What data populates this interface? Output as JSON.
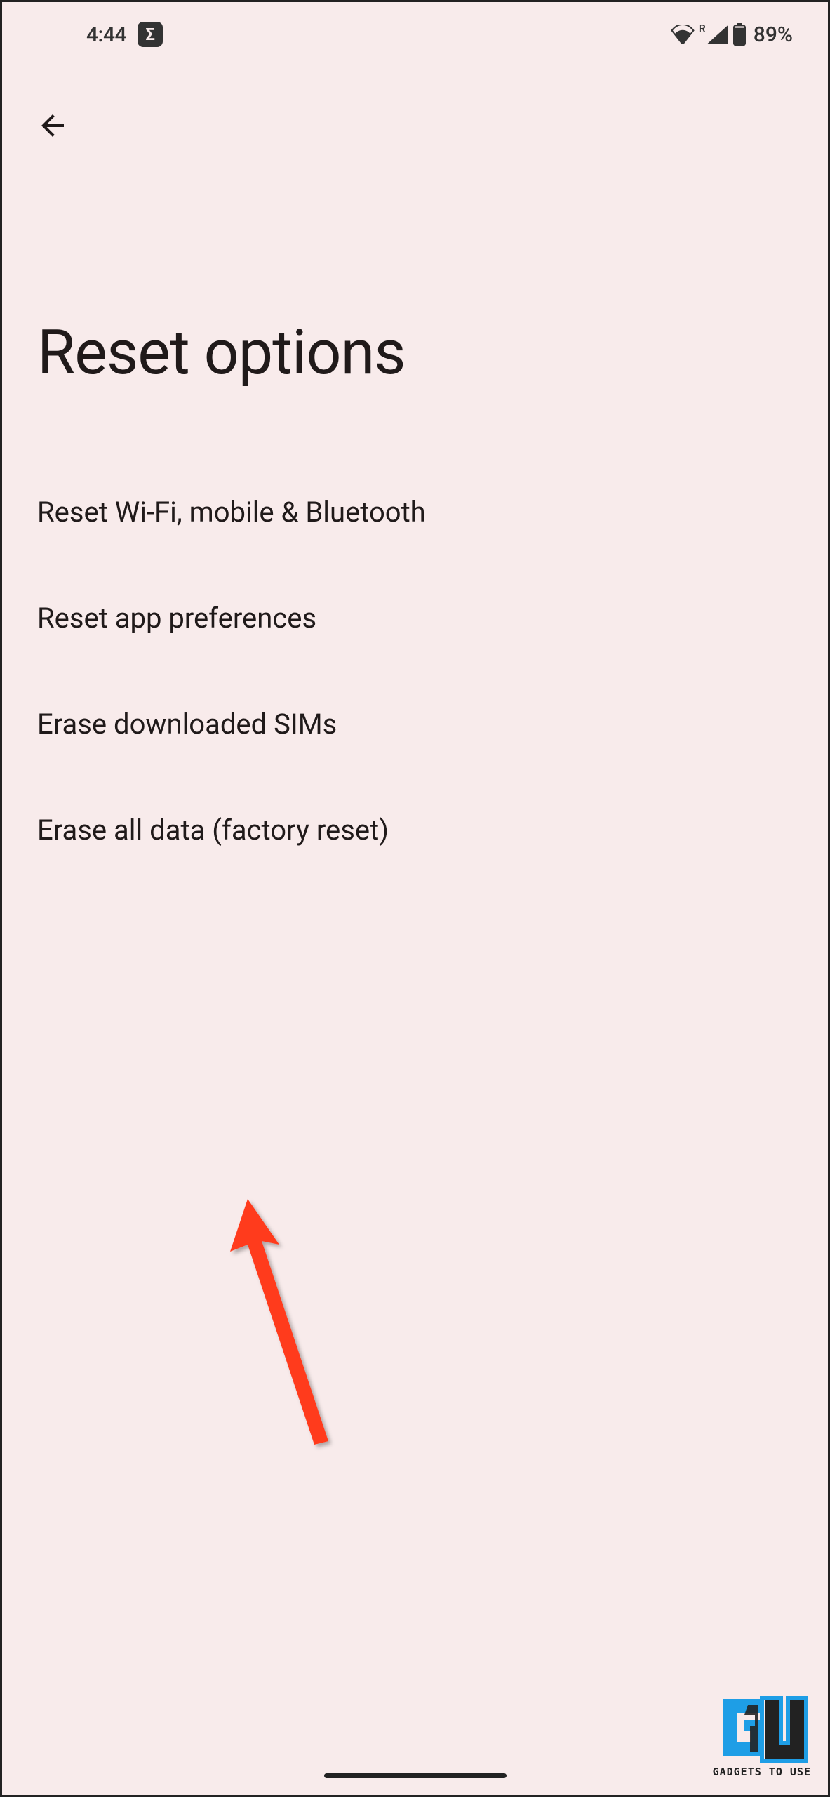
{
  "status_bar": {
    "time": "4:44",
    "battery_percent": "89%",
    "roaming_indicator": "R"
  },
  "header": {
    "title": "Reset options"
  },
  "options": [
    {
      "label": "Reset Wi-Fi, mobile & Bluetooth"
    },
    {
      "label": "Reset app preferences"
    },
    {
      "label": "Erase downloaded SIMs"
    },
    {
      "label": "Erase all data (factory reset)"
    }
  ],
  "watermark": {
    "text": "GADGETS TO USE"
  }
}
